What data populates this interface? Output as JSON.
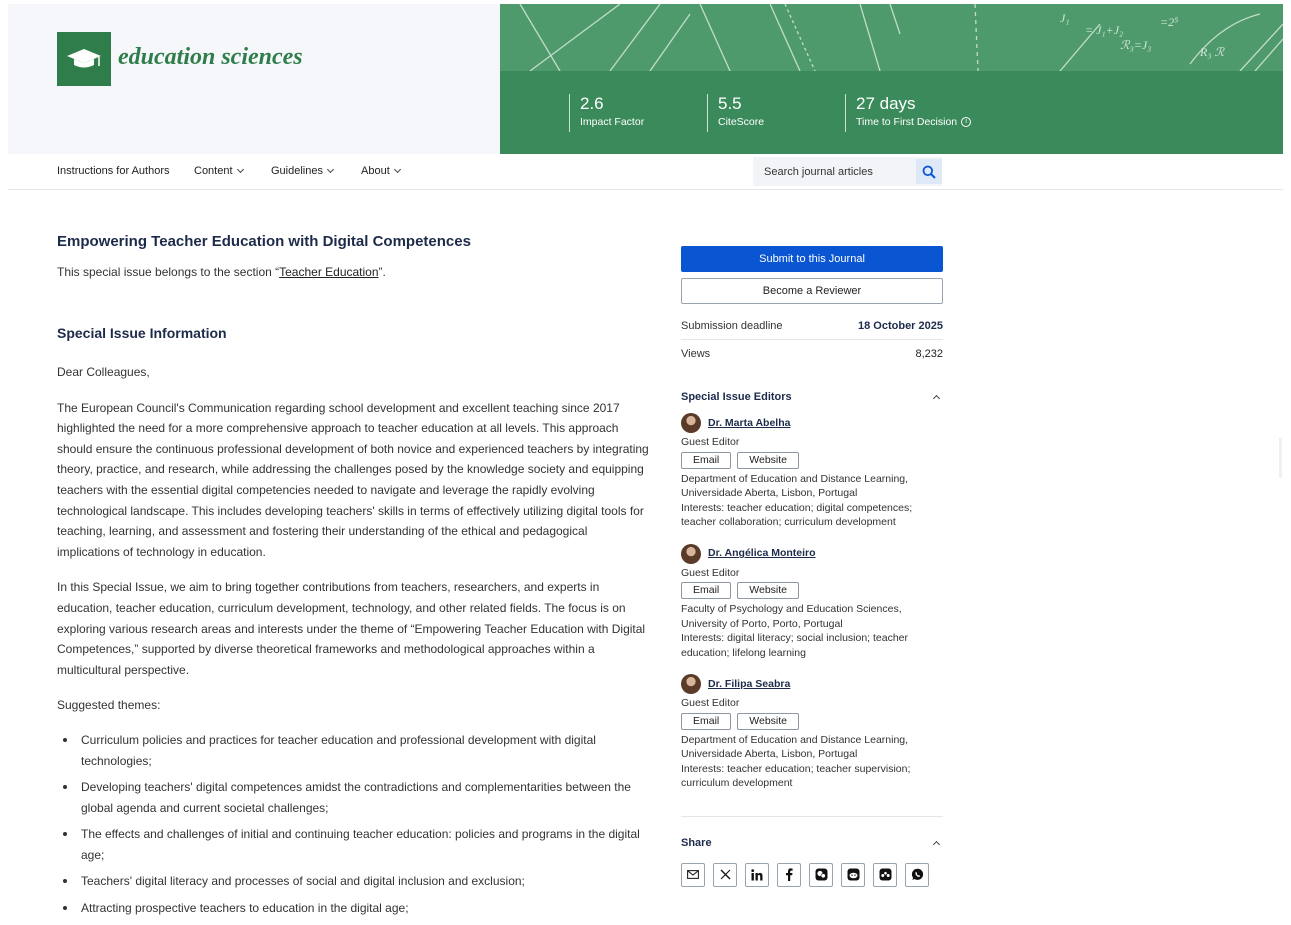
{
  "header": {
    "journal_name": "education sciences",
    "metrics": [
      {
        "value": "2.6",
        "label": "Impact Factor"
      },
      {
        "value": "5.5",
        "label": "CiteScore"
      },
      {
        "value": "27 days",
        "label": "Time to First Decision"
      }
    ]
  },
  "nav": {
    "items": [
      {
        "label": "Instructions for Authors"
      },
      {
        "label": "Content"
      },
      {
        "label": "Guidelines"
      },
      {
        "label": "About"
      }
    ],
    "search_placeholder": "Search journal articles"
  },
  "main": {
    "title": "Empowering Teacher Education with Digital Competences",
    "belongs_prefix": "This special issue belongs to the section “",
    "belongs_link": "Teacher Education",
    "belongs_suffix": "”.",
    "section_heading": "Special Issue Information",
    "paragraphs": [
      "Dear Colleagues,",
      "The European Council's Communication regarding school development and excellent teaching since 2017 highlighted the need for a more comprehensive approach to teacher education at all levels. This approach should ensure the continuous professional development of both novice and experienced teachers by integrating theory, practice, and research, while addressing the challenges posed by the knowledge society and equipping teachers with the essential digital competencies needed to navigate and leverage the rapidly evolving technological landscape. This includes developing teachers' skills in terms of effectively utilizing digital tools for teaching, learning, and assessment and fostering their understanding of the ethical and pedagogical implications of technology in education.",
      "In this Special Issue, we aim to bring together contributions from teachers, researchers, and experts in education, teacher education, curriculum development, technology, and other related fields. The focus is on exploring various research areas and interests under the theme of “Empowering Teacher Education with Digital Competences,” supported by diverse theoretical frameworks and methodological approaches within a multicultural perspective.",
      "Suggested themes:"
    ],
    "themes": [
      "Curriculum policies and practices for teacher education and professional development with digital technologies;",
      "Developing teachers' digital competences amidst the contradictions and complementarities between the global agenda and current societal challenges;",
      "The effects and challenges of initial and continuing teacher education: policies and programs in the digital age;",
      "Teachers' digital literacy and processes of social and digital inclusion and exclusion;",
      "Attracting prospective teachers to education in the digital age;"
    ]
  },
  "sidebar": {
    "submit_label": "Submit to this Journal",
    "reviewer_label": "Become a Reviewer",
    "deadline_label": "Submission deadline",
    "deadline_value": "18 October 2025",
    "views_label": "Views",
    "views_value": "8,232",
    "editors_heading": "Special Issue Editors",
    "editors": [
      {
        "name": "Dr. Marta Abelha",
        "role": "Guest Editor",
        "email_label": "Email",
        "website_label": "Website",
        "affiliation": "Department of Education and Distance Learning, Universidade Aberta, Lisbon, Portugal",
        "interests": "Interests: teacher education; digital competences; teacher collaboration; curriculum development"
      },
      {
        "name": "Dr. Angélica Monteiro",
        "role": "Guest Editor",
        "email_label": "Email",
        "website_label": "Website",
        "affiliation": "Faculty of Psychology and Education Sciences, University of Porto, Porto, Portugal",
        "interests": "Interests: digital literacy; social inclusion; teacher education; lifelong learning"
      },
      {
        "name": "Dr. Filipa Seabra",
        "role": "Guest Editor",
        "email_label": "Email",
        "website_label": "Website",
        "affiliation": "Department of Education and Distance Learning, Universidade Aberta, Lisbon, Portugal",
        "interests": "Interests: teacher education; teacher supervision; curriculum development"
      }
    ],
    "share_heading": "Share",
    "share_icons": [
      "email-icon",
      "x-icon",
      "linkedin-icon",
      "facebook-icon",
      "wechat-icon",
      "reddit-icon",
      "mendeley-icon",
      "whatsapp-icon"
    ]
  },
  "colors": {
    "brand_green": "#2f7d4a",
    "banner_green": "#3b8a5b",
    "primary_blue": "#0a55d1",
    "heading_navy": "#1d2b4a"
  }
}
